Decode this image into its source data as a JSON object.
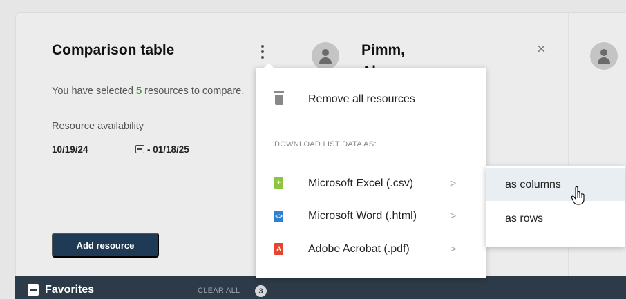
{
  "comparison": {
    "title": "Comparison table",
    "desc_pre": "You have selected ",
    "selected_count": "5",
    "desc_post": " resources to compare.",
    "availability_label": "Resource availability",
    "date_start": "10/19/24",
    "date_end": "- 01/18/25",
    "add_button": "Add resource"
  },
  "resource": {
    "name_line1": "Pimm,",
    "name_line2": "Al",
    "close": "×"
  },
  "menu": {
    "remove_all": "Remove all resources",
    "download_header": "DOWNLOAD LIST DATA AS:",
    "items": [
      {
        "label": "Microsoft Excel (.csv)",
        "icon": "excel-file-icon",
        "color": "#8cc63f",
        "chevron": ">"
      },
      {
        "label": "Microsoft Word (.html)",
        "icon": "word-file-icon",
        "color": "#2f7fd1",
        "chevron": ">"
      },
      {
        "label": "Adobe Acrobat (.pdf)",
        "icon": "pdf-file-icon",
        "color": "#e5452f",
        "chevron": ">"
      }
    ],
    "submenu": [
      "as columns",
      "as rows"
    ]
  },
  "favorites": {
    "label": "Favorites",
    "clear_all": "CLEAR ALL",
    "count": "3"
  },
  "colors": {
    "accent_green": "#3c9b2e",
    "button_navy": "#1f3a55",
    "bar_dark": "#2d3a47"
  }
}
